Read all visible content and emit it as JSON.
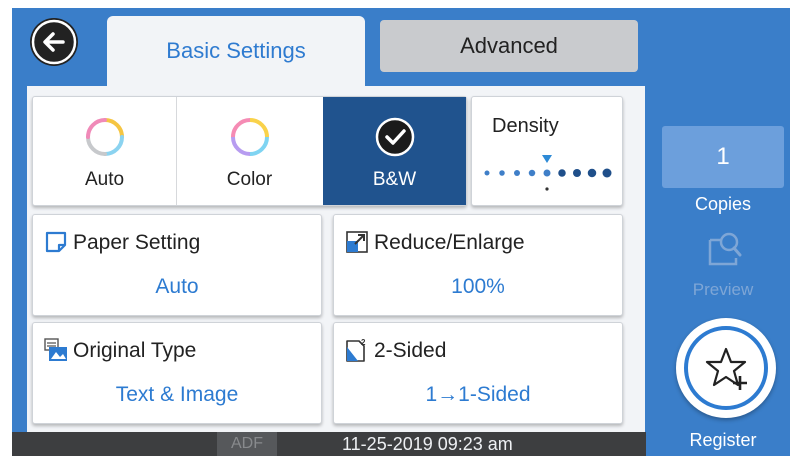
{
  "tabs": {
    "basic": "Basic Settings",
    "advanced": "Advanced"
  },
  "color_mode": {
    "options": [
      {
        "label": "Auto"
      },
      {
        "label": "Color"
      },
      {
        "label": "B&W"
      }
    ],
    "selected": "B&W"
  },
  "density": {
    "label": "Density",
    "level": 5,
    "levels": 9
  },
  "settings": {
    "paper": {
      "title": "Paper Setting",
      "value": "Auto"
    },
    "reduce": {
      "title": "Reduce/Enlarge",
      "value": "100%"
    },
    "original": {
      "title": "Original Type",
      "value": "Text & Image"
    },
    "two_sided": {
      "title": "2-Sided",
      "value": "1→1-Sided"
    }
  },
  "status": {
    "adf": "ADF",
    "datetime": "11-25-2019 09:23 am"
  },
  "copies": {
    "count": "1",
    "label": "Copies"
  },
  "preview": {
    "label": "Preview"
  },
  "register": {
    "label": "Register"
  },
  "colors": {
    "frame": "#3a7ec9",
    "selected": "#20538e",
    "value_text": "#2d7bd1"
  }
}
